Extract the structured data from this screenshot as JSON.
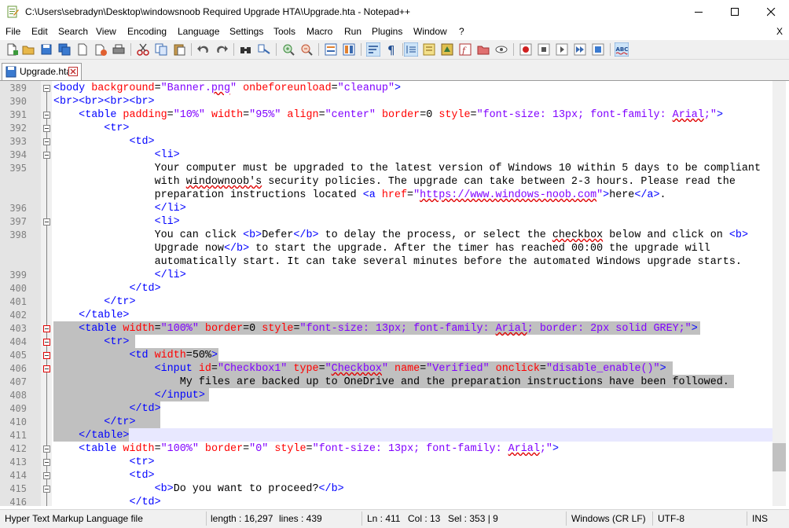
{
  "window": {
    "title": "C:\\Users\\sebradyn\\Desktop\\windowsnoob Required Upgrade HTA\\Upgrade.hta - Notepad++"
  },
  "menu": {
    "items": [
      "File",
      "Edit",
      "Search",
      "View",
      "Encoding",
      "Language",
      "Settings",
      "Tools",
      "Macro",
      "Run",
      "Plugins",
      "Window",
      "?"
    ],
    "close_label": "X"
  },
  "tab": {
    "label": "Upgrade.hta"
  },
  "editor": {
    "line_numbers": [
      "389",
      "390",
      "391",
      "392",
      "393",
      "394",
      "395",
      "",
      "",
      "396",
      "397",
      "398",
      "",
      "",
      "399",
      "400",
      "401",
      "402",
      "403",
      "404",
      "405",
      "406",
      "407",
      "408",
      "409",
      "410",
      "411",
      "412",
      "413",
      "414",
      "415",
      "416"
    ]
  },
  "status": {
    "language": "Hyper Text Markup Language file",
    "length": "length : 16,297",
    "lines": "lines : 439",
    "ln": "Ln : 411",
    "col": "Col : 13",
    "sel": "Sel : 353 | 9",
    "eol": "Windows (CR LF)",
    "encoding": "UTF-8",
    "mode": "INS"
  }
}
